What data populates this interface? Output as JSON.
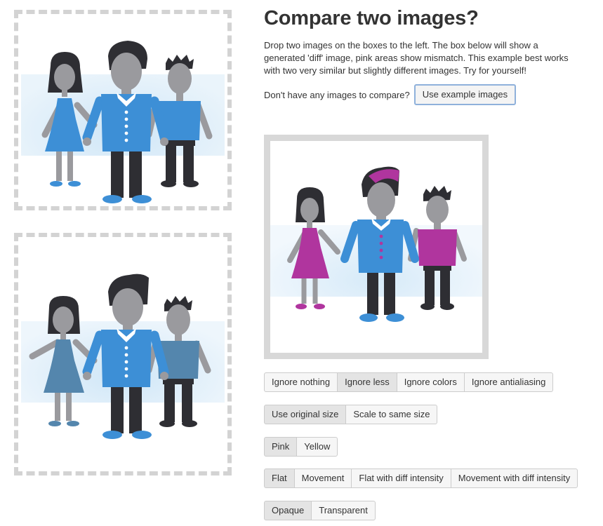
{
  "header": {
    "title": "Compare two images?",
    "description": "Drop two images on the boxes to the left. The box below will show a generated 'diff' image, pink areas show mismatch. This example best works with two very similar but slightly different images. Try for yourself!"
  },
  "example": {
    "prompt": "Don't have any images to compare?",
    "button_label": "Use example images"
  },
  "controls": {
    "ignore": {
      "options": [
        "Ignore nothing",
        "Ignore less",
        "Ignore colors",
        "Ignore antialiasing"
      ],
      "active": "Ignore less"
    },
    "size": {
      "options": [
        "Use original size",
        "Scale to same size"
      ],
      "active": "Use original size"
    },
    "error_color": {
      "options": [
        "Pink",
        "Yellow"
      ],
      "active": "Pink"
    },
    "mode": {
      "options": [
        "Flat",
        "Movement",
        "Flat with diff intensity",
        "Movement with diff intensity"
      ],
      "active": "Flat"
    },
    "transparency": {
      "options": [
        "Opaque",
        "Transparent"
      ],
      "active": "Opaque"
    }
  },
  "colors": {
    "accent_blue": "#3d8fd6",
    "dark_hair": "#2e2e33",
    "skin_gray": "#9a9a9e",
    "diff_pink": "#b0359e",
    "muted_blue": "#5486ad",
    "glow": "#cfe6f7",
    "drop_border": "#d3d3d3"
  }
}
